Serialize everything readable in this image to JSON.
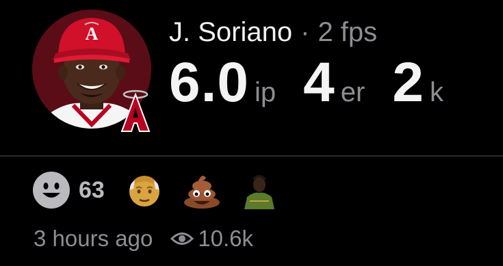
{
  "player": {
    "name": "J. Soriano",
    "separator": "·",
    "fps": "2 fps",
    "team_logo_letter": "A"
  },
  "stats": [
    {
      "value": "6.0",
      "unit": "ip"
    },
    {
      "value": "4",
      "unit": "er"
    },
    {
      "value": "2",
      "unit": "k"
    }
  ],
  "reactions": {
    "count": "63",
    "add_icon": "smile-face-icon",
    "items": [
      {
        "icon": "old-man-emoji"
      },
      {
        "icon": "poop-emoji"
      },
      {
        "icon": "player-photo-emoji"
      }
    ]
  },
  "meta": {
    "time": "3 hours ago",
    "views": "10.6k",
    "views_icon": "eye-icon"
  },
  "colors": {
    "background": "#000000",
    "primary_text": "#f2f2f2",
    "secondary_text": "#8d8d93",
    "divider": "#2a2a2d",
    "team_red": "#ba0021"
  }
}
